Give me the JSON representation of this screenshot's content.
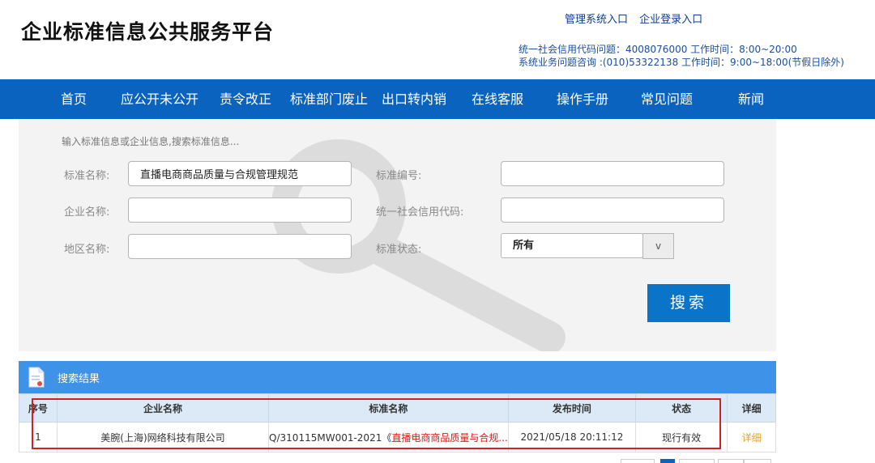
{
  "header": {
    "title": "企业标准信息公共服务平台",
    "links": [
      "管理系统入口",
      "企业登录入口"
    ],
    "contact_line1": "统一社会信用代码问题：4008076000 工作时间：8:00~20:00",
    "contact_line2": "系统业务问题咨询 :(010)53322138 工作时间：9:00~18:00(节假日除外)"
  },
  "nav": {
    "items": [
      "首页",
      "应公开未公开",
      "责令改正",
      "标准部门废止",
      "出口转内销",
      "在线客服",
      "操作手册",
      "常见问题",
      "新闻"
    ]
  },
  "search": {
    "hint": "输入标准信息或企业信息,搜索标准信息...",
    "std_name_label": "标准名称:",
    "std_name_value": "直播电商商品质量与合规管理规范",
    "std_no_label": "标准编号:",
    "std_no_value": "",
    "company_label": "企业名称:",
    "company_value": "",
    "credit_label": "统一社会信用代码:",
    "credit_value": "",
    "region_label": "地区名称:",
    "region_value": "",
    "status_label": "标准状态:",
    "status_value": "所有",
    "dropdown_glyph": "v",
    "search_button": "搜索"
  },
  "results": {
    "title": "搜索结果",
    "columns": [
      "序号",
      "企业名称",
      "标准名称",
      "发布时间",
      "状态",
      "详细"
    ],
    "rows": [
      {
        "index": "1",
        "company": "美腕(上海)网络科技有限公司",
        "std_prefix": "Q/310115MW001-2021《",
        "std_title": "直播电商商品质量与合规...",
        "date": "2021/05/18 20:11:12",
        "status": "现行有效",
        "detail": "详细"
      }
    ]
  },
  "colors": {
    "nav_bg": "#0a63bf",
    "results_bar": "#3e93e8",
    "search_button": "#0a74c9",
    "highlight": "#d81e1e",
    "detail_link": "#f0a020"
  }
}
